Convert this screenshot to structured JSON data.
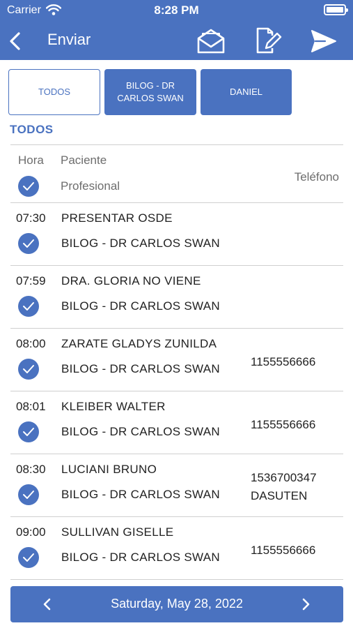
{
  "status_bar": {
    "carrier": "Carrier",
    "time": "8:28 PM"
  },
  "nav": {
    "title": "Enviar",
    "icons": [
      "back-chevron-icon",
      "open-envelope-icon",
      "edit-document-icon",
      "send-icon"
    ]
  },
  "filters": [
    {
      "label": "TODOS",
      "active": true
    },
    {
      "label_line1": "BILOG - DR",
      "label_line2": "CARLOS SWAN",
      "active": false
    },
    {
      "label": "DANIEL",
      "active": false
    }
  ],
  "section_title": "TODOS",
  "table": {
    "headers": {
      "hora": "Hora",
      "paciente": "Paciente",
      "profesional": "Profesional",
      "telefono": "Teléfono"
    },
    "rows": [
      {
        "time": "07:30",
        "patient": "PRESENTAR OSDE",
        "professional": "BILOG - DR CARLOS SWAN",
        "phone": "",
        "phone2": ""
      },
      {
        "time": "07:59",
        "patient": "DRA. GLORIA NO VIENE",
        "professional": "BILOG - DR CARLOS SWAN",
        "phone": "",
        "phone2": ""
      },
      {
        "time": "08:00",
        "patient": "ZARATE GLADYS ZUNILDA",
        "professional": "BILOG - DR CARLOS SWAN",
        "phone": "1155556666",
        "phone2": ""
      },
      {
        "time": "08:01",
        "patient": "KLEIBER WALTER",
        "professional": "BILOG - DR CARLOS SWAN",
        "phone": "1155556666",
        "phone2": ""
      },
      {
        "time": "08:30",
        "patient": "LUCIANI BRUNO",
        "professional": "BILOG - DR CARLOS SWAN",
        "phone": "1536700347",
        "phone2": "DASUTEN"
      },
      {
        "time": "09:00",
        "patient": "SULLIVAN GISELLE",
        "professional": "BILOG - DR CARLOS SWAN",
        "phone": "1155556666",
        "phone2": ""
      }
    ]
  },
  "footer": {
    "date": "Saturday, May 28, 2022"
  },
  "colors": {
    "primary": "#4a72c0",
    "divider": "#cfcfcf",
    "text": "#222222",
    "header_text": "#6d6d6d"
  }
}
